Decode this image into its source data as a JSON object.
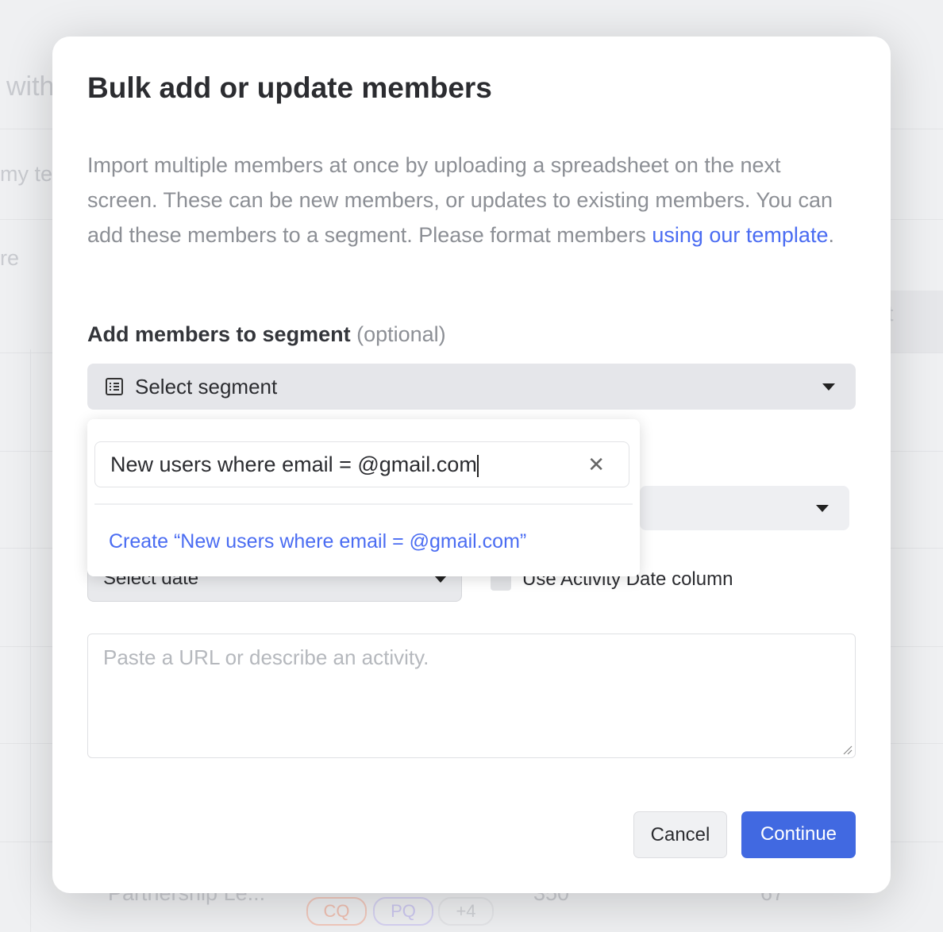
{
  "background": {
    "heading_fragment": "with",
    "filter_fragment": "my te",
    "dropdown_fragment": "re",
    "column_fragment": "t",
    "row_name": "Partnership Le...",
    "tags": [
      "CQ",
      "PQ",
      "+4"
    ],
    "row_values": [
      "350",
      "67"
    ]
  },
  "modal": {
    "title": "Bulk add or update members",
    "description": "Import multiple members at once by uploading a spreadsheet on the next screen. These can be new members, or updates to existing members. You can add these members to a segment. Please format members ",
    "template_link": "using our template",
    "description_end": ".",
    "segment_label": "Add members to segment",
    "segment_label_optional": "(optional)",
    "segment_select": {
      "value": "Select segment",
      "icon": "list-icon"
    },
    "segment_search": {
      "value": "New users where email = @gmail.com",
      "create_option": "Create “New users where email = @gmail.com”"
    },
    "date_select": "Select date",
    "use_activity_date_checkbox": {
      "label": "Use Activity Date column",
      "checked": false
    },
    "activity_textarea": {
      "placeholder": "Paste a URL or describe an activity.",
      "value": ""
    },
    "cancel_label": "Cancel",
    "continue_label": "Continue"
  },
  "colors": {
    "accent": "#4169e1",
    "link": "#4a6cf2"
  }
}
